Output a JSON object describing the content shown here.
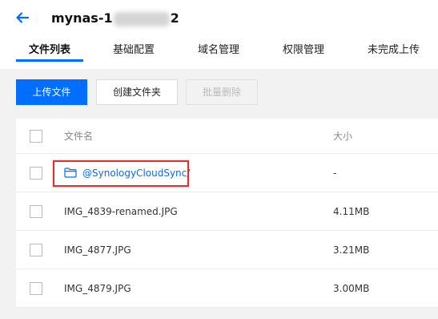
{
  "header": {
    "title_prefix": "mynas-1",
    "title_suffix": "2",
    "back_icon": "arrow-left-icon"
  },
  "tabs": [
    {
      "label": "文件列表",
      "active": true
    },
    {
      "label": "基础配置",
      "active": false
    },
    {
      "label": "域名管理",
      "active": false
    },
    {
      "label": "权限管理",
      "active": false
    },
    {
      "label": "未完成上传",
      "active": false
    }
  ],
  "toolbar": {
    "upload_label": "上传文件",
    "create_folder_label": "创建文件夹",
    "batch_delete_label": "批量删除"
  },
  "table": {
    "columns": {
      "name": "文件名",
      "size": "大小"
    },
    "rows": [
      {
        "name": "@SynologyCloudSync/",
        "size": "-",
        "type": "folder",
        "icon": "folder-icon"
      },
      {
        "name": "IMG_4839-renamed.JPG",
        "size": "4.11MB",
        "type": "file"
      },
      {
        "name": "IMG_4877.JPG",
        "size": "3.21MB",
        "type": "file"
      },
      {
        "name": "IMG_4879.JPG",
        "size": "3.00MB",
        "type": "file"
      }
    ]
  },
  "colors": {
    "accent": "#006eff",
    "highlight": "#e03030",
    "background": "#f2f2f2"
  }
}
